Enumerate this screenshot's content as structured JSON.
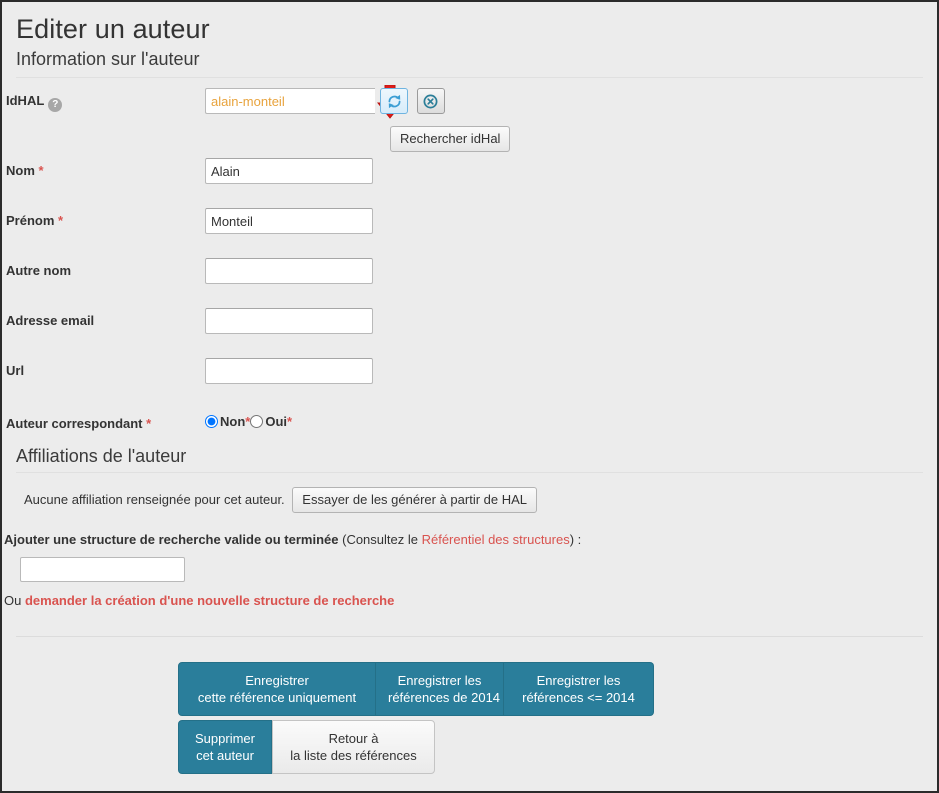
{
  "header": {
    "title": "Editer un auteur",
    "subtitle": "Information sur l'auteur"
  },
  "form": {
    "idhal": {
      "label": "IdHAL",
      "help_icon": "question-mark-icon",
      "value": "alain-monteil",
      "placeholder": "",
      "refresh_icon": "refresh-icon",
      "clear_icon": "clear-circle-icon",
      "search_button": "Rechercher idHal"
    },
    "nom": {
      "label": "Nom",
      "required": "*",
      "value": "Alain",
      "placeholder": ""
    },
    "prenom": {
      "label": "Prénom",
      "required": "*",
      "value": "Monteil",
      "placeholder": ""
    },
    "autre_nom": {
      "label": "Autre nom",
      "value": "",
      "placeholder": ""
    },
    "email": {
      "label": "Adresse email",
      "value": "",
      "placeholder": ""
    },
    "url": {
      "label": "Url",
      "value": "",
      "placeholder": ""
    },
    "auteur_correspondant": {
      "label": "Auteur correspondant",
      "required": "*",
      "options": [
        {
          "label": "Non",
          "selected": true,
          "marker": "*"
        },
        {
          "label": "Oui",
          "selected": false,
          "marker": "*"
        }
      ]
    }
  },
  "affiliations": {
    "section_title": "Affiliations de l'auteur",
    "empty_note": "Aucune affiliation renseignée pour cet auteur.",
    "generate_button": "Essayer de les générer à partir de HAL",
    "add_label_strong": "Ajouter une structure de recherche valide ou terminée",
    "add_label_prefix": " (Consultez le ",
    "add_label_link": "Référentiel des structures",
    "add_label_suffix": ") :",
    "add_input_value": "",
    "add_input_placeholder": "",
    "or_prefix": "Ou ",
    "or_link": "demander la création d'une nouvelle structure de recherche"
  },
  "footer": {
    "save_this_only": "Enregistrer\ncette référence uniquement",
    "save_this_only_line1": "Enregistrer",
    "save_this_only_line2": "cette référence uniquement",
    "save_2014_line1": "Enregistrer les",
    "save_2014_line2": "références de 2014",
    "save_lte2014_line1": "Enregistrer les",
    "save_lte2014_line2": "références <= 2014",
    "delete_line1": "Supprimer",
    "delete_line2": "cet auteur",
    "back_line1": "Retour à",
    "back_line2": "la liste des références"
  },
  "annotation": {
    "arrow_icon": "down-arrow-icon",
    "arrow_color": "#e01b18"
  },
  "colors": {
    "page_bg": "#ececec",
    "accent_teal": "#2a7e9b",
    "link_red": "#d9534f",
    "idhal_value": "#e8a33d"
  }
}
